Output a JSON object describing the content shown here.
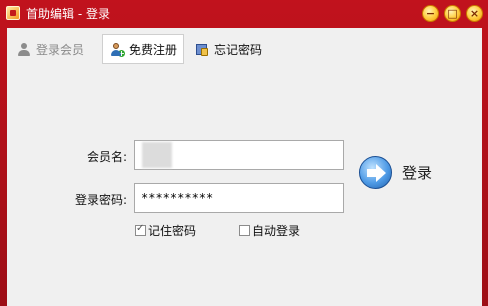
{
  "window": {
    "title": "首助编辑 - 登录"
  },
  "tabs": [
    {
      "label": "登录会员"
    },
    {
      "label": "免费注册"
    },
    {
      "label": "忘记密码"
    }
  ],
  "form": {
    "username_label": "会员名:",
    "username_value": "",
    "password_label": "登录密码:",
    "password_value": "**********",
    "remember_label": "记住密码",
    "remember_checked": true,
    "autologin_label": "自动登录",
    "autologin_checked": false,
    "login_label": "登录"
  },
  "colors": {
    "frame": "#b3121a",
    "panel": "#f0f0f0",
    "accent": "#4f9be6"
  },
  "icons": [
    "app-icon",
    "minimize-icon",
    "maximize-icon",
    "close-icon",
    "user-icon",
    "user-add-icon",
    "password-icon",
    "arrow-right-icon"
  ]
}
